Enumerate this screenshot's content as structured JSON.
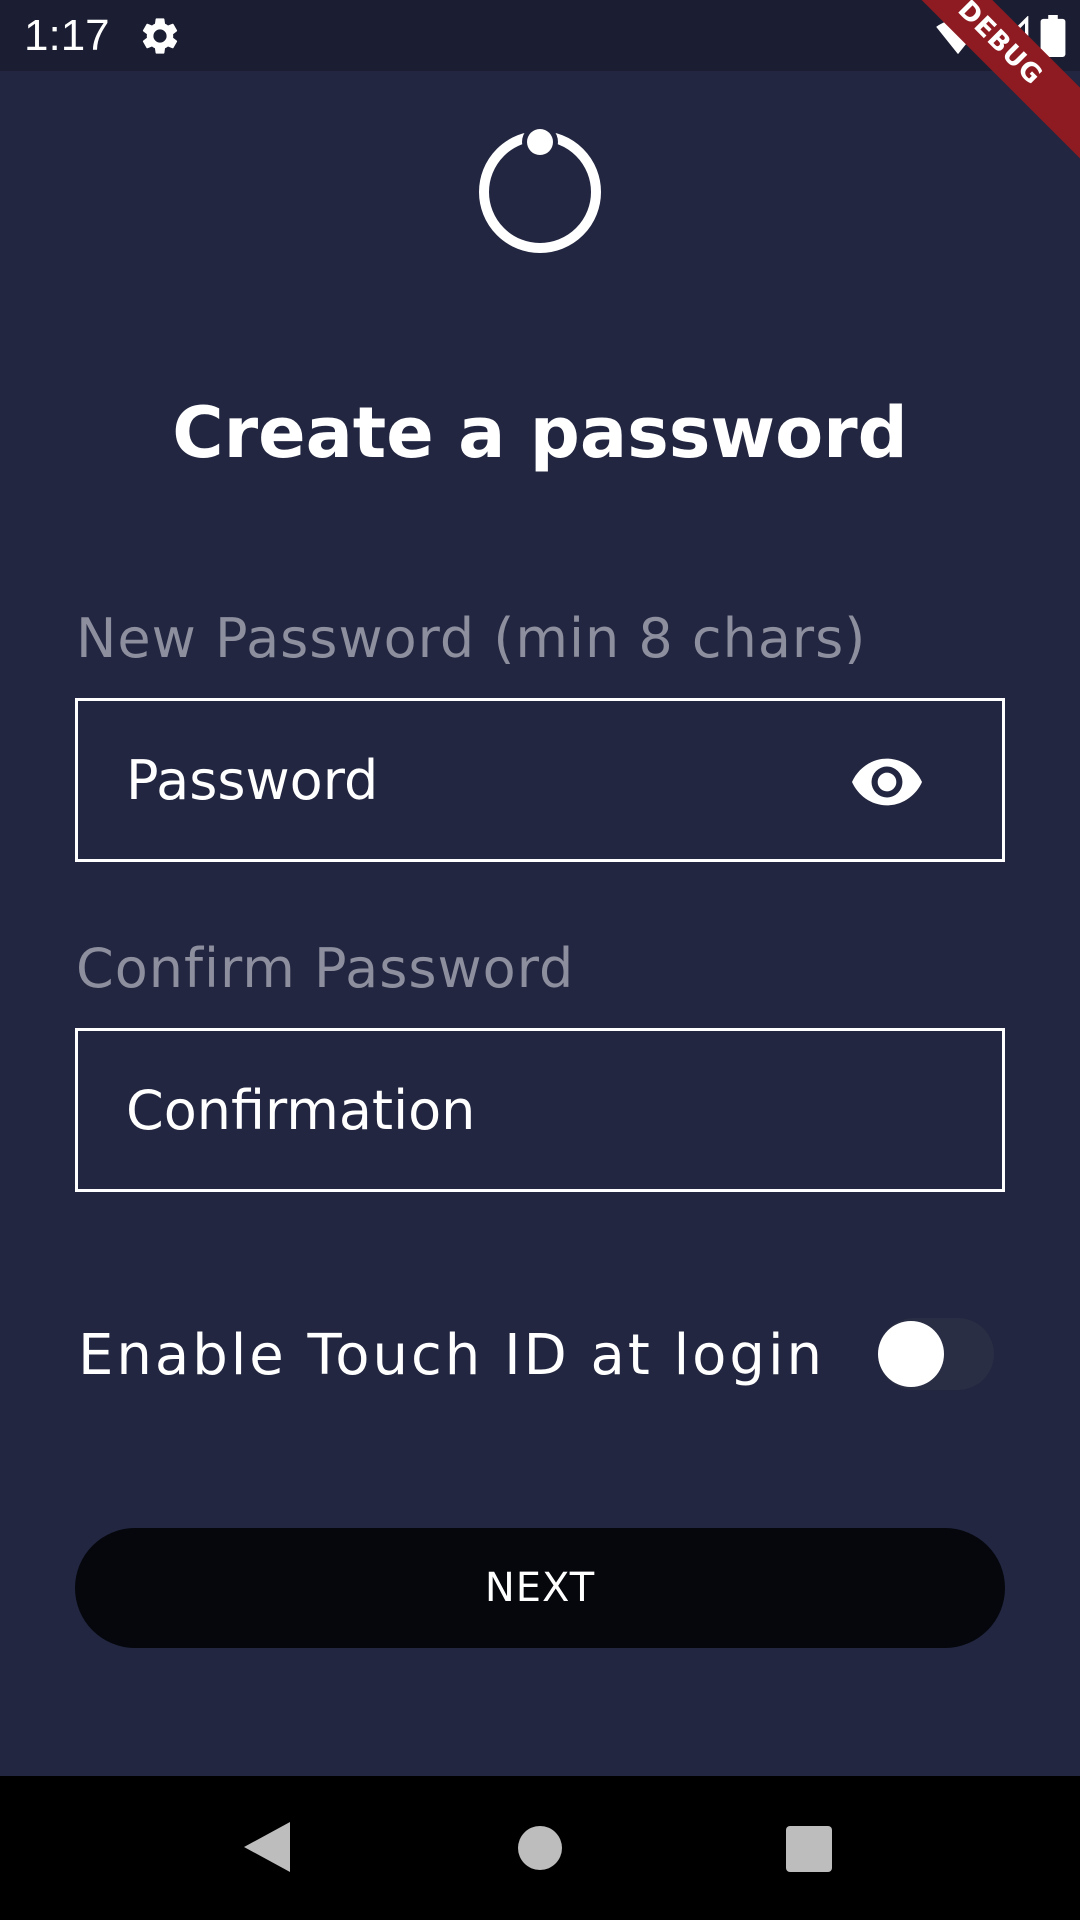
{
  "status_bar": {
    "time": "1:17",
    "settings_icon": "gear-icon",
    "wifi_icon": "wifi-icon",
    "signal_icon": "cell-signal-icon",
    "battery_icon": "battery-icon"
  },
  "debug_banner": "DEBUG",
  "logo_icon": "power-ring-logo",
  "title": "Create a password",
  "new_password": {
    "label": "New Password (min 8 chars)",
    "placeholder": "Password",
    "toggle_icon": "eye-icon"
  },
  "confirm_password": {
    "label": "Confirm Password",
    "placeholder": "Confirmation"
  },
  "touch_id": {
    "label": "Enable Touch ID at login",
    "enabled": false
  },
  "next_button": "NEXT",
  "nav_bar": {
    "back_icon": "back-triangle-icon",
    "home_icon": "home-circle-icon",
    "recents_icon": "recents-square-icon"
  },
  "colors": {
    "background": "#222640",
    "status_bar": "#1b1e32",
    "button": "#05070d",
    "label_muted": "#8d8f9e",
    "debug": "#8f1b22"
  }
}
